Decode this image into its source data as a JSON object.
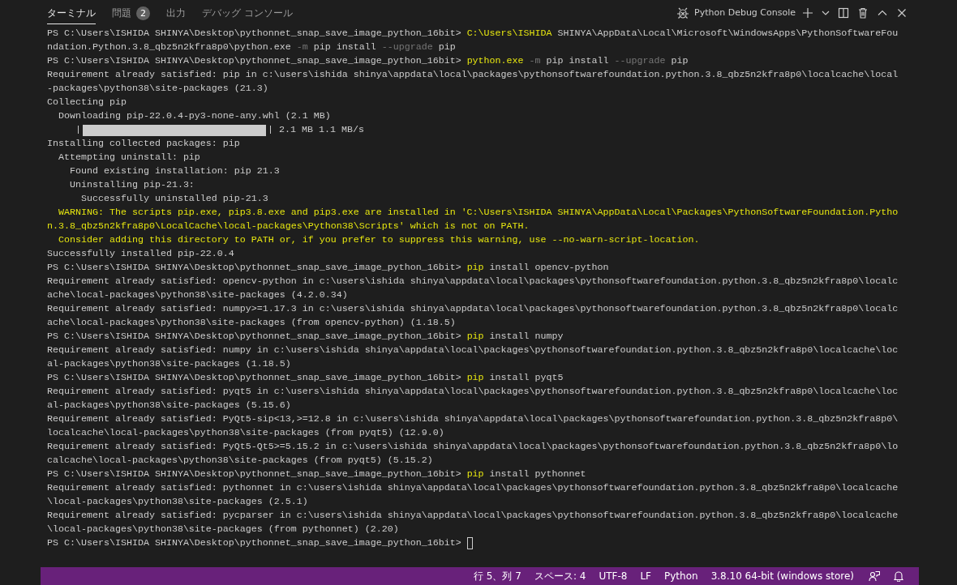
{
  "panel": {
    "tabs": [
      {
        "label": "ターミナル",
        "selected": true
      },
      {
        "label": "問題",
        "selected": false,
        "badge": "2"
      },
      {
        "label": "出力",
        "selected": false
      },
      {
        "label": "デバッグ コンソール",
        "selected": false
      }
    ],
    "terminal_name": "Python Debug Console"
  },
  "terminal": {
    "lines": [
      {
        "segments": [
          {
            "kind": "text",
            "text": "PS C:\\Users\\ISHIDA SHINYA\\Desktop\\pythonnet_snap_save_image_python_16bit> "
          },
          {
            "kind": "cmd",
            "text": "C:\\Users\\ISHIDA"
          },
          {
            "kind": "text",
            "text": " SHINYA\\AppData\\Local\\Microsoft\\WindowsApps\\PythonSoftwareFou"
          }
        ]
      },
      {
        "segments": [
          {
            "kind": "text",
            "text": "ndation.Python.3.8_qbz5n2kfra8p0\\python.exe "
          },
          {
            "kind": "flag",
            "text": "-m"
          },
          {
            "kind": "text",
            "text": " pip install "
          },
          {
            "kind": "flag",
            "text": "--upgrade"
          },
          {
            "kind": "text",
            "text": " pip"
          }
        ]
      },
      {
        "segments": [
          {
            "kind": "text",
            "text": "PS C:\\Users\\ISHIDA SHINYA\\Desktop\\pythonnet_snap_save_image_python_16bit> "
          },
          {
            "kind": "cmd",
            "text": "python.exe"
          },
          {
            "kind": "flag",
            "text": " -m"
          },
          {
            "kind": "text",
            "text": " pip install "
          },
          {
            "kind": "flag",
            "text": "--upgrade"
          },
          {
            "kind": "text",
            "text": " pip"
          }
        ]
      },
      {
        "segments": [
          {
            "kind": "text",
            "text": "Requirement already satisfied: pip in c:\\users\\ishida shinya\\appdata\\local\\packages\\pythonsoftwarefoundation.python.3.8_qbz5n2kfra8p0\\localcache\\local"
          }
        ]
      },
      {
        "segments": [
          {
            "kind": "text",
            "text": "-packages\\python38\\site-packages (21.3)"
          }
        ]
      },
      {
        "segments": [
          {
            "kind": "text",
            "text": "Collecting pip"
          }
        ]
      },
      {
        "segments": [
          {
            "kind": "text",
            "text": "  Downloading pip-22.0.4-py3-none-any.whl (2.1 MB)"
          }
        ]
      },
      {
        "kind": "progress",
        "left": "|",
        "level": 1,
        "right": "| 2.1 MB 1.1 MB/s"
      },
      {
        "segments": [
          {
            "kind": "text",
            "text": "Installing collected packages: pip"
          }
        ]
      },
      {
        "segments": [
          {
            "kind": "text",
            "text": "  Attempting uninstall: pip"
          }
        ]
      },
      {
        "segments": [
          {
            "kind": "text",
            "text": "    Found existing installation: pip 21.3"
          }
        ]
      },
      {
        "segments": [
          {
            "kind": "text",
            "text": "    Uninstalling pip-21.3:"
          }
        ]
      },
      {
        "segments": [
          {
            "kind": "text",
            "text": "      Successfully uninstalled pip-21.3"
          }
        ]
      },
      {
        "segments": [
          {
            "kind": "warn",
            "text": "  WARNING: The scripts pip.exe, pip3.8.exe and pip3.exe are installed in 'C:\\Users\\ISHIDA SHINYA\\AppData\\Local\\Packages\\PythonSoftwareFoundation.Pytho"
          }
        ]
      },
      {
        "segments": [
          {
            "kind": "warn",
            "text": "n.3.8_qbz5n2kfra8p0\\LocalCache\\local-packages\\Python38\\Scripts' which is not on PATH."
          }
        ]
      },
      {
        "segments": [
          {
            "kind": "warn",
            "text": "  Consider adding this directory to PATH or, if you prefer to suppress this warning, use --no-warn-script-location."
          }
        ]
      },
      {
        "segments": [
          {
            "kind": "text",
            "text": "Successfully installed pip-22.0.4"
          }
        ]
      },
      {
        "segments": [
          {
            "kind": "text",
            "text": "PS C:\\Users\\ISHIDA SHINYA\\Desktop\\pythonnet_snap_save_image_python_16bit> "
          },
          {
            "kind": "cmd",
            "text": "pip"
          },
          {
            "kind": "text",
            "text": " install opencv-python"
          }
        ]
      },
      {
        "segments": [
          {
            "kind": "text",
            "text": "Requirement already satisfied: opencv-python in c:\\users\\ishida shinya\\appdata\\local\\packages\\pythonsoftwarefoundation.python.3.8_qbz5n2kfra8p0\\localc"
          }
        ]
      },
      {
        "segments": [
          {
            "kind": "text",
            "text": "ache\\local-packages\\python38\\site-packages (4.2.0.34)"
          }
        ]
      },
      {
        "segments": [
          {
            "kind": "text",
            "text": "Requirement already satisfied: numpy>=1.17.3 in c:\\users\\ishida shinya\\appdata\\local\\packages\\pythonsoftwarefoundation.python.3.8_qbz5n2kfra8p0\\localc"
          }
        ]
      },
      {
        "segments": [
          {
            "kind": "text",
            "text": "ache\\local-packages\\python38\\site-packages (from opencv-python) (1.18.5)"
          }
        ]
      },
      {
        "segments": [
          {
            "kind": "text",
            "text": "PS C:\\Users\\ISHIDA SHINYA\\Desktop\\pythonnet_snap_save_image_python_16bit> "
          },
          {
            "kind": "cmd",
            "text": "pip"
          },
          {
            "kind": "text",
            "text": " install numpy"
          }
        ]
      },
      {
        "segments": [
          {
            "kind": "text",
            "text": "Requirement already satisfied: numpy in c:\\users\\ishida shinya\\appdata\\local\\packages\\pythonsoftwarefoundation.python.3.8_qbz5n2kfra8p0\\localcache\\loc"
          }
        ]
      },
      {
        "segments": [
          {
            "kind": "text",
            "text": "al-packages\\python38\\site-packages (1.18.5)"
          }
        ]
      },
      {
        "segments": [
          {
            "kind": "text",
            "text": "PS C:\\Users\\ISHIDA SHINYA\\Desktop\\pythonnet_snap_save_image_python_16bit> "
          },
          {
            "kind": "cmd",
            "text": "pip"
          },
          {
            "kind": "text",
            "text": " install pyqt5"
          }
        ]
      },
      {
        "segments": [
          {
            "kind": "text",
            "text": "Requirement already satisfied: pyqt5 in c:\\users\\ishida shinya\\appdata\\local\\packages\\pythonsoftwarefoundation.python.3.8_qbz5n2kfra8p0\\localcache\\loc"
          }
        ]
      },
      {
        "segments": [
          {
            "kind": "text",
            "text": "al-packages\\python38\\site-packages (5.15.6)"
          }
        ]
      },
      {
        "segments": [
          {
            "kind": "text",
            "text": "Requirement already satisfied: PyQt5-sip<13,>=12.8 in c:\\users\\ishida shinya\\appdata\\local\\packages\\pythonsoftwarefoundation.python.3.8_qbz5n2kfra8p0\\"
          }
        ]
      },
      {
        "segments": [
          {
            "kind": "text",
            "text": "localcache\\local-packages\\python38\\site-packages (from pyqt5) (12.9.0)"
          }
        ]
      },
      {
        "segments": [
          {
            "kind": "text",
            "text": "Requirement already satisfied: PyQt5-Qt5>=5.15.2 in c:\\users\\ishida shinya\\appdata\\local\\packages\\pythonsoftwarefoundation.python.3.8_qbz5n2kfra8p0\\lo"
          }
        ]
      },
      {
        "segments": [
          {
            "kind": "text",
            "text": "calcache\\local-packages\\python38\\site-packages (from pyqt5) (5.15.2)"
          }
        ]
      },
      {
        "segments": [
          {
            "kind": "text",
            "text": "PS C:\\Users\\ISHIDA SHINYA\\Desktop\\pythonnet_snap_save_image_python_16bit> "
          },
          {
            "kind": "cmd",
            "text": "pip"
          },
          {
            "kind": "text",
            "text": " install pythonnet"
          }
        ]
      },
      {
        "segments": [
          {
            "kind": "text",
            "text": "Requirement already satisfied: pythonnet in c:\\users\\ishida shinya\\appdata\\local\\packages\\pythonsoftwarefoundation.python.3.8_qbz5n2kfra8p0\\localcache"
          }
        ]
      },
      {
        "segments": [
          {
            "kind": "text",
            "text": "\\local-packages\\python38\\site-packages (2.5.1)"
          }
        ]
      },
      {
        "segments": [
          {
            "kind": "text",
            "text": "Requirement already satisfied: pycparser in c:\\users\\ishida shinya\\appdata\\local\\packages\\pythonsoftwarefoundation.python.3.8_qbz5n2kfra8p0\\localcache"
          }
        ]
      },
      {
        "segments": [
          {
            "kind": "text",
            "text": "\\local-packages\\python38\\site-packages (from pythonnet) (2.20)"
          }
        ]
      },
      {
        "segments": [
          {
            "kind": "text",
            "text": "PS C:\\Users\\ISHIDA SHINYA\\Desktop\\pythonnet_snap_save_image_python_16bit>"
          }
        ],
        "cursor": true
      }
    ]
  },
  "status_bar": {
    "items": [
      "行 5、列 7",
      "スペース: 4",
      "UTF-8",
      "LF",
      "Python",
      "3.8.10 64-bit (windows store)"
    ]
  }
}
